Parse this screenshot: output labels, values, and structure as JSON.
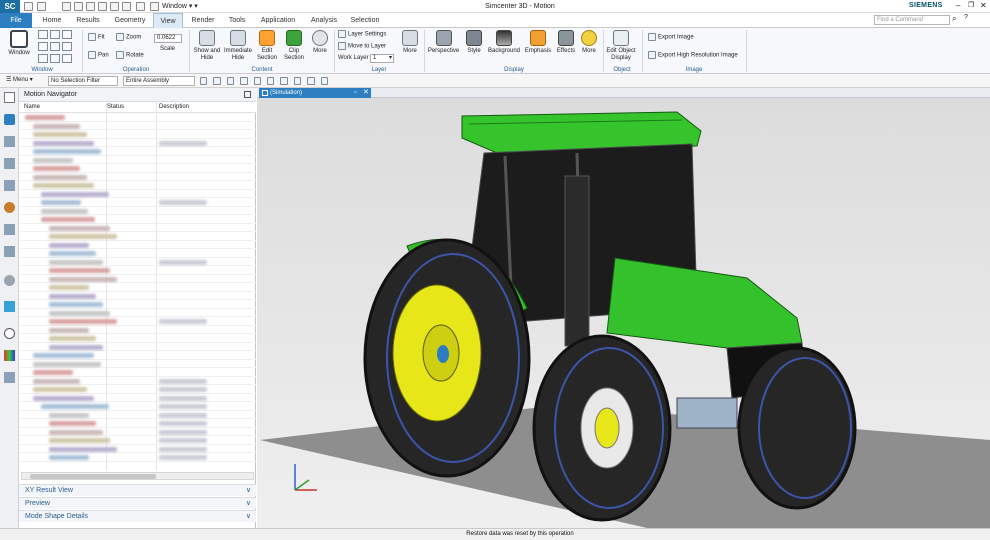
{
  "window": {
    "title": "Simcenter 3D - Motion",
    "brand": "SIEMENS",
    "logo": "SC",
    "window_menu": "Window"
  },
  "tabs": [
    "File",
    "Home",
    "Results",
    "Geometry",
    "View",
    "Render",
    "Tools",
    "Application",
    "Analysis",
    "Selection"
  ],
  "active_tab": "View",
  "command_finder": {
    "placeholder": "Find a Command"
  },
  "ribbon": {
    "window_group": {
      "label": "Window",
      "button": "Window"
    },
    "operation_group": {
      "label": "Operation",
      "fit": "Fit",
      "zoom": "Zoom",
      "pan": "Pan",
      "rotate": "Rotate",
      "scale_value": "0.0622",
      "scale_label": "Scale"
    },
    "content_group": {
      "label": "Content",
      "buttons": [
        "Show and Hide",
        "Immediate Hide",
        "Edit Section",
        "Clip Section",
        "More"
      ]
    },
    "layer_group": {
      "label": "Layer",
      "layer_settings": "Layer Settings",
      "move_to_layer": "Move to Layer",
      "work_layer_label": "Work Layer",
      "work_layer_value": "1",
      "more": "More"
    },
    "display_group": {
      "label": "Display",
      "buttons": [
        "Perspective",
        "Style",
        "Background",
        "Emphasis",
        "Effects",
        "More"
      ]
    },
    "object_group": {
      "label": "Object",
      "button": "Edit Object Display"
    },
    "image_group": {
      "label": "Image",
      "export_image": "Export Image",
      "export_high_res": "Export High Resolution Image"
    }
  },
  "selection_bar": {
    "menu": "Menu",
    "filter": "No Selection Filter",
    "scope": "Entire Assembly"
  },
  "navigator": {
    "title": "Motion Navigator",
    "columns": [
      "Name",
      "Status",
      "Description"
    ],
    "collapsed_panels": [
      "XY Result View",
      "Preview",
      "Mode Shape Details"
    ]
  },
  "document_tab": {
    "label": "(Simulation)"
  },
  "status": {
    "message": "Restore data was reset by this operation"
  },
  "colors": {
    "accent": "#2d7fc1",
    "tractor_green": "#2fb52a",
    "rim_yellow": "#e6e619"
  }
}
